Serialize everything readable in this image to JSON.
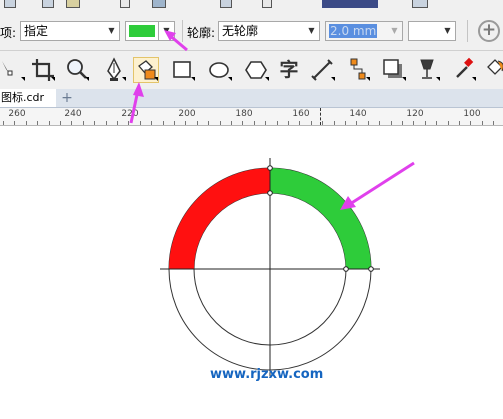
{
  "propbar": {
    "mode_label": "项:",
    "mode_value": "指定",
    "outline_label": "轮廓:",
    "outline_value": "无轮廓",
    "width_value": "2.0 mm",
    "add_symbol": "+"
  },
  "colors": {
    "fill_swatch": "#2ecc3a",
    "arc_red": "#ff1010",
    "arc_green": "#2ecc3a",
    "arrow": "#e040ec",
    "watermark": "#1565c0"
  },
  "toolbar": {
    "text_tool_glyph": "字"
  },
  "tabs": {
    "doc_name": "图标.cdr",
    "add_tab": "+"
  },
  "ruler": {
    "labels": [
      "260",
      "240",
      "220",
      "200",
      "180",
      "160",
      "140",
      "120",
      "100"
    ]
  },
  "watermark": "www.rjzxw.com"
}
